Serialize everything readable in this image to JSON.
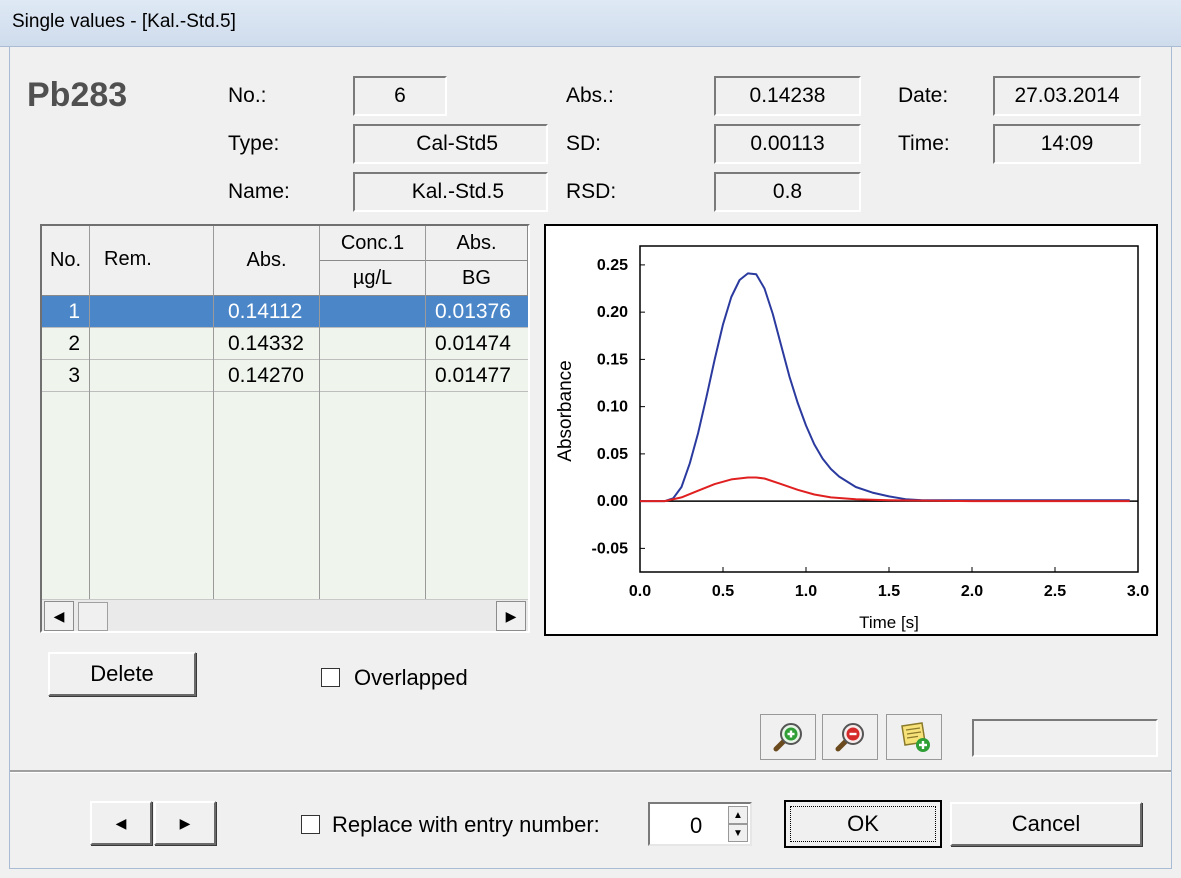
{
  "window": {
    "title": "Single values - [Kal.-Std.5]"
  },
  "element": "Pb283",
  "info": {
    "no_label": "No.:",
    "no_value": "6",
    "type_label": "Type:",
    "type_value": "Cal-Std5",
    "name_label": "Name:",
    "name_value": "Kal.-Std.5",
    "abs_label": "Abs.:",
    "abs_value": "0.14238",
    "sd_label": "SD:",
    "sd_value": "0.00113",
    "rsd_label": "RSD:",
    "rsd_value": "0.8",
    "date_label": "Date:",
    "date_value": "27.03.2014",
    "time_label": "Time:",
    "time_value": "14:09"
  },
  "table": {
    "headers": {
      "no": "No.",
      "rem": "Rem.",
      "abs": "Abs.",
      "conc": "Conc.1",
      "conc_unit": "µg/L",
      "absbg": "Abs.",
      "absbg_sub": "BG"
    },
    "rows": [
      {
        "no": "1",
        "rem": "",
        "abs": "0.14112",
        "conc": "",
        "absbg": "0.01376",
        "selected": true
      },
      {
        "no": "2",
        "rem": "",
        "abs": "0.14332",
        "conc": "",
        "absbg": "0.01474",
        "selected": false
      },
      {
        "no": "3",
        "rem": "",
        "abs": "0.14270",
        "conc": "",
        "absbg": "0.01477",
        "selected": false
      }
    ]
  },
  "chart_data": {
    "type": "line",
    "title": "",
    "xlabel": "Time [s]",
    "ylabel": "Absorbance",
    "xlim": [
      0.0,
      3.0
    ],
    "ylim": [
      -0.075,
      0.27
    ],
    "xticks": [
      "0.0",
      "0.5",
      "1.0",
      "1.5",
      "2.0",
      "2.5",
      "3.0"
    ],
    "yticks": [
      "0.25",
      "0.20",
      "0.15",
      "0.10",
      "0.05",
      "0.00",
      "-0.05"
    ],
    "grid": false,
    "series": [
      {
        "color": "#2b3a9e",
        "x": [
          0.0,
          0.15,
          0.2,
          0.25,
          0.3,
          0.35,
          0.4,
          0.45,
          0.5,
          0.55,
          0.6,
          0.65,
          0.7,
          0.75,
          0.8,
          0.85,
          0.9,
          0.95,
          1.0,
          1.05,
          1.1,
          1.15,
          1.2,
          1.3,
          1.4,
          1.5,
          1.6,
          1.7,
          2.0,
          2.5,
          2.95
        ],
        "y": [
          0.0,
          0.0,
          0.003,
          0.015,
          0.04,
          0.072,
          0.11,
          0.15,
          0.187,
          0.216,
          0.234,
          0.241,
          0.24,
          0.225,
          0.198,
          0.165,
          0.132,
          0.104,
          0.08,
          0.06,
          0.045,
          0.034,
          0.026,
          0.015,
          0.009,
          0.005,
          0.002,
          0.001,
          0.001,
          0.001,
          0.001
        ]
      },
      {
        "color": "#e02020",
        "x": [
          0.0,
          0.15,
          0.25,
          0.35,
          0.45,
          0.55,
          0.65,
          0.7,
          0.75,
          0.85,
          0.95,
          1.05,
          1.15,
          1.3,
          1.5,
          2.0,
          2.5,
          2.95
        ],
        "y": [
          0.0,
          0.0,
          0.004,
          0.011,
          0.018,
          0.023,
          0.025,
          0.025,
          0.024,
          0.018,
          0.012,
          0.007,
          0.004,
          0.002,
          0.001,
          0.0,
          0.0,
          0.0
        ]
      }
    ]
  },
  "controls": {
    "delete_label": "Delete",
    "overlapped_label": "Overlapped",
    "overlapped_checked": false,
    "replace_label": "Replace with entry number:",
    "replace_checked": false,
    "entry_number": "0",
    "ok_label": "OK",
    "cancel_label": "Cancel"
  },
  "icons": [
    "zoom-in-icon",
    "zoom-out-icon",
    "notes-add-icon",
    "arrow-left-icon",
    "arrow-right-icon"
  ]
}
